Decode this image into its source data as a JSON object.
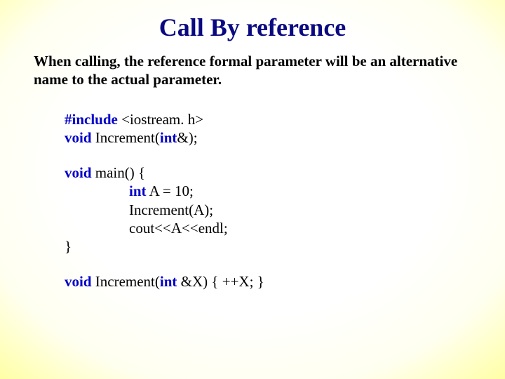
{
  "title": "Call By reference",
  "intro": "When calling, the reference formal parameter will be an alternative name to the actual parameter.",
  "code": {
    "l1a": "#include",
    "l1b": " <iostream. h>",
    "l2a": "void",
    "l2b": " Increment(",
    "l2c": "int",
    "l2d": "&);",
    "l3a": "void",
    "l3b": " main() {",
    "l4a": "int",
    "l4b": " A = 10;",
    "l5": "Increment(A);",
    "l6": "cout<<A<<endl;",
    "l7": "}",
    "l8a": "void",
    "l8b": " Increment(",
    "l8c": "int",
    "l8d": " &X) { ++X; }"
  }
}
